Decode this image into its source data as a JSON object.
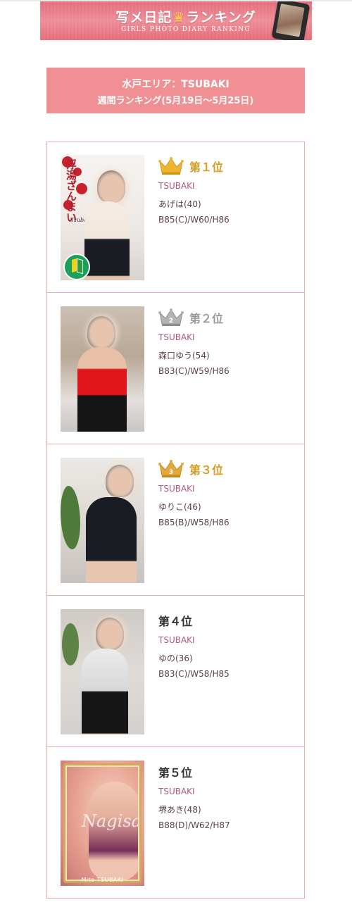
{
  "banner": {
    "title_left": "写メ日記",
    "crown": "♛",
    "title_right": "ランキング",
    "subtitle": "GIRLS PHOTO DIARY RANKING"
  },
  "heading": {
    "line1": "水戸エリア：TSUBAKI",
    "line2": "週間ランキング(5月19日〜5月25日)"
  },
  "colors": {
    "banner": "#e36d79",
    "heading_bg": "#f19094",
    "card_border": "#f0a9ab",
    "gold": "#d79e24",
    "silver": "#9b9b9b",
    "shop_text": "#b05a74"
  },
  "photo_texts": {
    "rank1_vertical": "浮湯ざんまい",
    "rank1_brand": "Tsubaki",
    "rank5_script": "Nagisa",
    "rank5_caption": "Mito TSUBAKI"
  },
  "rankings": [
    {
      "rank": "第１位",
      "crown": "gold-crown-icon",
      "crown_num": "",
      "shop": "TSUBAKI",
      "name": "あげは(40)",
      "size": "B85(C)/W60/H86",
      "badge": "beginner-mark-icon"
    },
    {
      "rank": "第２位",
      "crown": "silver-crown-icon",
      "crown_num": "2",
      "shop": "TSUBAKI",
      "name": "森口ゆう(54)",
      "size": "B83(C)/W59/H86"
    },
    {
      "rank": "第３位",
      "crown": "bronze-crown-icon",
      "crown_num": "3",
      "shop": "TSUBAKI",
      "name": "ゆりこ(46)",
      "size": "B85(B)/W58/H86"
    },
    {
      "rank": "第４位",
      "shop": "TSUBAKI",
      "name": "ゆの(36)",
      "size": "B83(C)/W58/H85"
    },
    {
      "rank": "第５位",
      "shop": "TSUBAKI",
      "name": "堺あき(48)",
      "size": "B88(D)/W62/H87"
    }
  ]
}
